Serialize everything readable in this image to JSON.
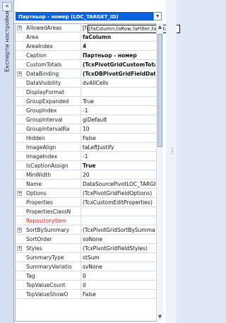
{
  "sidebar": {
    "collapse": "«",
    "title": "Експерти настройки"
  },
  "combo": {
    "value": "Партньор - номер (LOC_TARGET_ID)"
  },
  "tooltip": "[faColumn,faRow,faFilter,faData]",
  "rows": [
    {
      "name": "AllowedAreas",
      "value": "[faColumn,faRow,faFilter,faData]",
      "expand": "+",
      "bold": false,
      "red": false
    },
    {
      "name": "Area",
      "value": "faColumn",
      "expand": "",
      "bold": true,
      "red": false
    },
    {
      "name": "AreaIndex",
      "value": "4",
      "expand": "",
      "bold": true,
      "red": false
    },
    {
      "name": "Caption",
      "value": "Партньор - номер",
      "expand": "",
      "bold": true,
      "red": false
    },
    {
      "name": "CustomTotals",
      "value": "(TcxPivotGridCustomTotal",
      "expand": "",
      "bold": true,
      "red": false
    },
    {
      "name": "DataBinding",
      "value": "(TcxDBPivotGridFieldDataB",
      "expand": "+",
      "bold": true,
      "red": false
    },
    {
      "name": "DataVisibility",
      "value": "dvAllCells",
      "expand": "",
      "bold": false,
      "red": false
    },
    {
      "name": "DisplayFormat",
      "value": "",
      "expand": "",
      "bold": false,
      "red": false
    },
    {
      "name": "GroupExpanded",
      "value": "True",
      "expand": "",
      "bold": false,
      "red": false
    },
    {
      "name": "GroupIndex",
      "value": "-1",
      "expand": "",
      "bold": false,
      "red": false
    },
    {
      "name": "GroupInterval",
      "value": "giDefault",
      "expand": "",
      "bold": false,
      "red": false
    },
    {
      "name": "GroupIntervalRa",
      "value": "10",
      "expand": "",
      "bold": false,
      "red": false
    },
    {
      "name": "Hidden",
      "value": "False",
      "expand": "",
      "bold": false,
      "red": false
    },
    {
      "name": "ImageAlign",
      "value": "taLeftJustify",
      "expand": "",
      "bold": false,
      "red": false
    },
    {
      "name": "ImageIndex",
      "value": "-1",
      "expand": "",
      "bold": false,
      "red": false
    },
    {
      "name": "IsCaptionAssign",
      "value": "True",
      "expand": "",
      "bold": true,
      "red": false
    },
    {
      "name": "MinWidth",
      "value": "20",
      "expand": "",
      "bold": false,
      "red": false
    },
    {
      "name": "Name",
      "value": "DataSourcePivotLOC_TARGET_",
      "expand": "",
      "bold": false,
      "red": false
    },
    {
      "name": "Options",
      "value": "(TcxPivotGridFieldOptions)",
      "expand": "+",
      "bold": false,
      "red": false
    },
    {
      "name": "Properties",
      "value": "(TcxCustomEditProperties)",
      "expand": "",
      "bold": false,
      "red": false
    },
    {
      "name": "PropertiesClassN",
      "value": "",
      "expand": "",
      "bold": false,
      "red": false
    },
    {
      "name": "RepositoryItem",
      "value": "",
      "expand": "",
      "bold": false,
      "red": true
    },
    {
      "name": "SortBySummary",
      "value": "(TcxPivotGridSortBySummaryIn",
      "expand": "+",
      "bold": false,
      "red": false
    },
    {
      "name": "SortOrder",
      "value": "soNone",
      "expand": "",
      "bold": false,
      "red": false
    },
    {
      "name": "Styles",
      "value": "(TcxPivotGridFieldStyles)",
      "expand": "+",
      "bold": false,
      "red": false
    },
    {
      "name": "SummaryType",
      "value": "stSum",
      "expand": "",
      "bold": false,
      "red": false
    },
    {
      "name": "SummaryVariatio",
      "value": "svNone",
      "expand": "",
      "bold": false,
      "red": false
    },
    {
      "name": "Tag",
      "value": "0",
      "expand": "",
      "bold": false,
      "red": false
    },
    {
      "name": "TopValueCount",
      "value": "0",
      "expand": "",
      "bold": false,
      "red": false
    },
    {
      "name": "TopValueShowO",
      "value": "False",
      "expand": "",
      "bold": false,
      "red": false
    }
  ]
}
